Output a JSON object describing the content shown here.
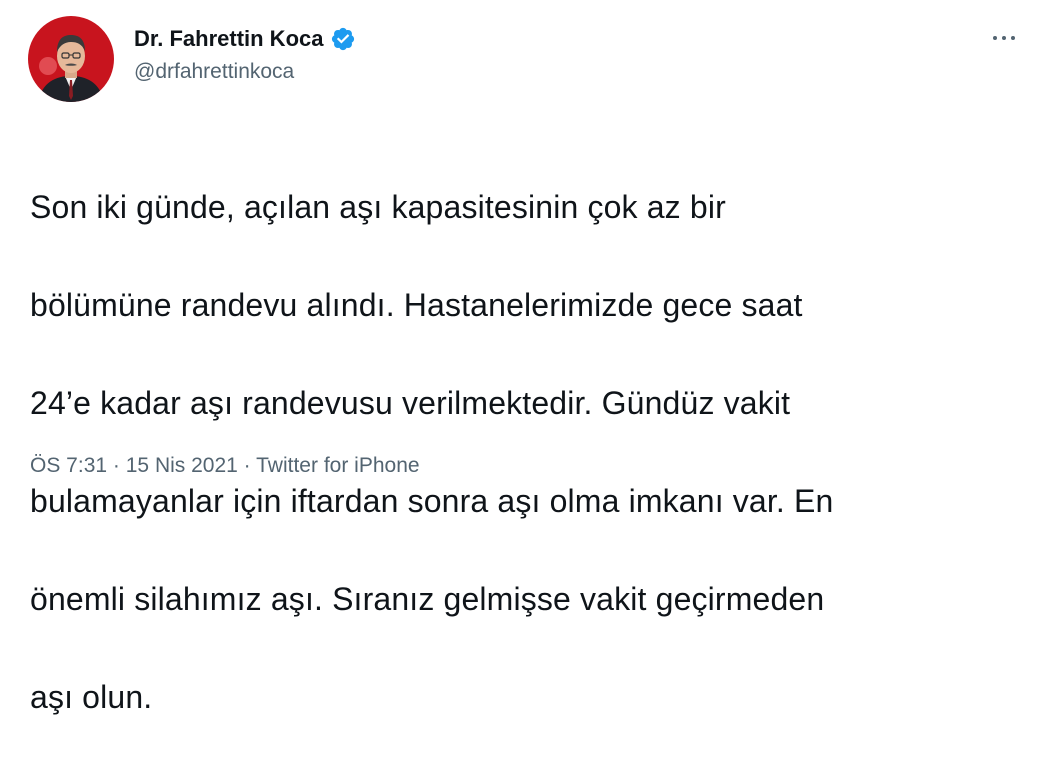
{
  "author": {
    "name": "Dr. Fahrettin Koca",
    "handle": "@drfahrettinkoca",
    "verified": true,
    "avatar_icon": "profile-photo"
  },
  "more_icon": "more-horizontal-icon",
  "tweet": {
    "lines": [
      "Son iki günde, açılan aşı kapasitesinin çok az bir",
      "bölümüne randevu alındı. Hastanelerimizde gece saat",
      "24’e kadar aşı randevusu verilmektedir. Gündüz vakit",
      "bulamayanlar için iftardan sonra aşı olma imkanı var. En",
      "önemli silahımız aşı. Sıranız gelmişse vakit geçirmeden",
      "aşı olun."
    ]
  },
  "meta": {
    "time": "ÖS 7:31",
    "separator": "·",
    "date": "15 Nis 2021",
    "source": "Twitter for iPhone"
  },
  "colors": {
    "text": "#0f1419",
    "secondary": "#536471",
    "verified": "#1d9bf0"
  }
}
